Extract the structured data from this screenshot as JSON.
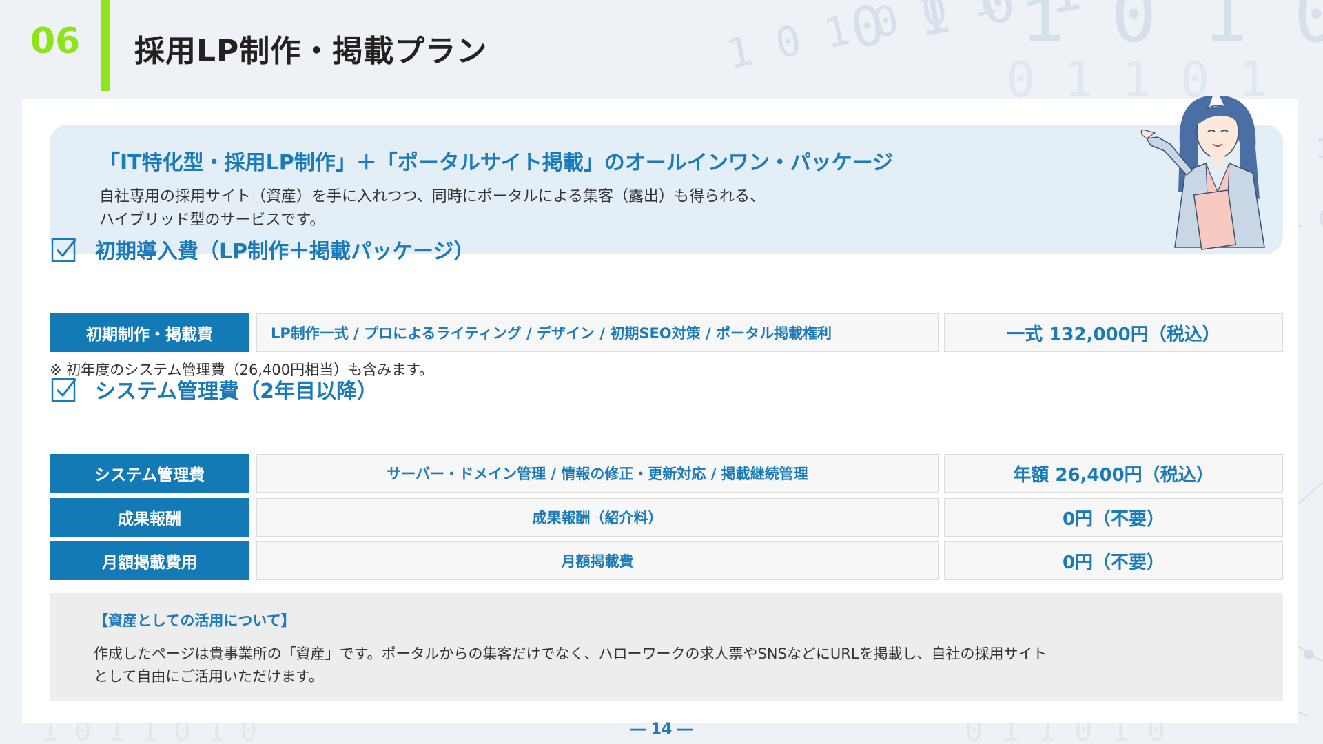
{
  "header": {
    "section_number": "06",
    "title": "採用LP制作・掲載プラン"
  },
  "intro": {
    "title": "「IT特化型・採用LP制作」＋「ポータルサイト掲載」のオールインワン・パッケージ",
    "body_line1": "自社専用の採用サイト（資産）を手に入れつつ、同時にポータルによる集客（露出）も得られる、",
    "body_line2": "ハイブリッド型のサービスです。"
  },
  "initial": {
    "heading": "初期導入費（LP制作＋掲載パッケージ）",
    "row": {
      "label": "初期制作・掲載費",
      "description": "LP制作一式 / プロによるライティング / デザイン / 初期SEO対策 / ポータル掲載権利",
      "price": "一式 132,000円（税込）"
    },
    "note": "※ 初年度のシステム管理費（26,400円相当）も含みます。"
  },
  "system": {
    "heading": "システム管理費（2年目以降）",
    "rows": [
      {
        "label": "システム管理費",
        "description": "サーバー・ドメイン管理 / 情報の修正・更新対応 / 掲載継続管理",
        "price": "年額 26,400円（税込）"
      },
      {
        "label": "成果報酬",
        "description": "成果報酬（紹介料）",
        "price": "0円（不要）"
      },
      {
        "label": "月額掲載費用",
        "description": "月額掲載費",
        "price": "0円（不要）"
      }
    ]
  },
  "asset": {
    "title": "【資産としての活用について】",
    "body_line1": "作成したページは貴事業所の「資産」です。ポータルからの集客だけでなく、ハローワークの求人票やSNSなどにURLを掲載し、自社の採用サイト",
    "body_line2": "として自由にご活用いただけます。"
  },
  "footer": {
    "page_number": "― 14 ―"
  },
  "colors": {
    "accent_green": "#8fe31a",
    "primary_blue": "#1b7ab8",
    "label_blue": "#137ab5",
    "intro_bg": "#e3eef7",
    "note_bg": "#ededed"
  },
  "icons": [
    "check-box-icon",
    "presenter-woman-illustration"
  ]
}
